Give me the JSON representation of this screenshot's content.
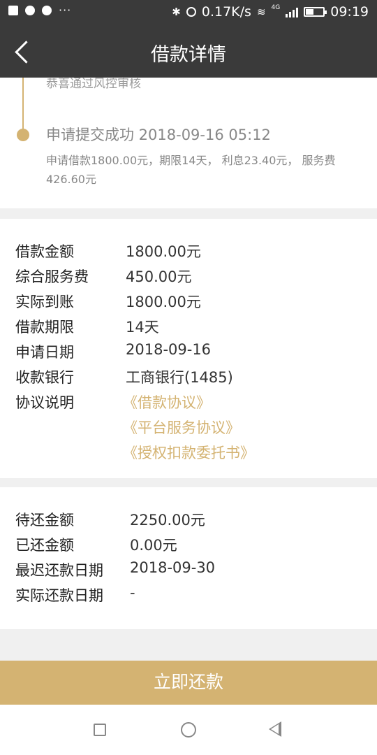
{
  "status_bar": {
    "speed": "0.17K/s",
    "network": "4G",
    "time": "09:19",
    "battery_level": 0.4
  },
  "header": {
    "title": "借款详情"
  },
  "timeline": {
    "previous_text": "恭喜通过风控审核",
    "current_title": "申请提交成功 2018-09-16 05:12",
    "current_desc": "申请借款1800.00元，期限14天， 利息23.40元， 服务费426.60元"
  },
  "details": {
    "rows": [
      {
        "label": "借款金额",
        "value": "1800.00元"
      },
      {
        "label": "综合服务费",
        "value": "450.00元"
      },
      {
        "label": "实际到账",
        "value": "1800.00元"
      },
      {
        "label": "借款期限",
        "value": "14天"
      },
      {
        "label": "申请日期",
        "value": "2018-09-16"
      },
      {
        "label": "收款银行",
        "value": "工商银行(1485)"
      }
    ],
    "agreement_label": "协议说明",
    "agreements": [
      "《借款协议》",
      "《平台服务协议》",
      "《授权扣款委托书》"
    ]
  },
  "repayment": {
    "rows": [
      {
        "label": "待还金额",
        "value": "2250.00元"
      },
      {
        "label": "已还金额",
        "value": "0.00元"
      },
      {
        "label": "最迟还款日期",
        "value": "2018-09-30"
      },
      {
        "label": "实际还款日期",
        "value": "-"
      }
    ]
  },
  "button": {
    "label": "立即还款"
  },
  "colors": {
    "accent": "#d4b372",
    "header_bg": "#3a3a3a"
  },
  "icons": [
    "image-icon",
    "download-icon",
    "download-icon",
    "bluetooth-icon",
    "alarm-icon",
    "wifi-icon",
    "signal-icon",
    "battery-icon",
    "back-arrow-icon",
    "recents-icon",
    "home-icon",
    "nav-back-icon"
  ]
}
